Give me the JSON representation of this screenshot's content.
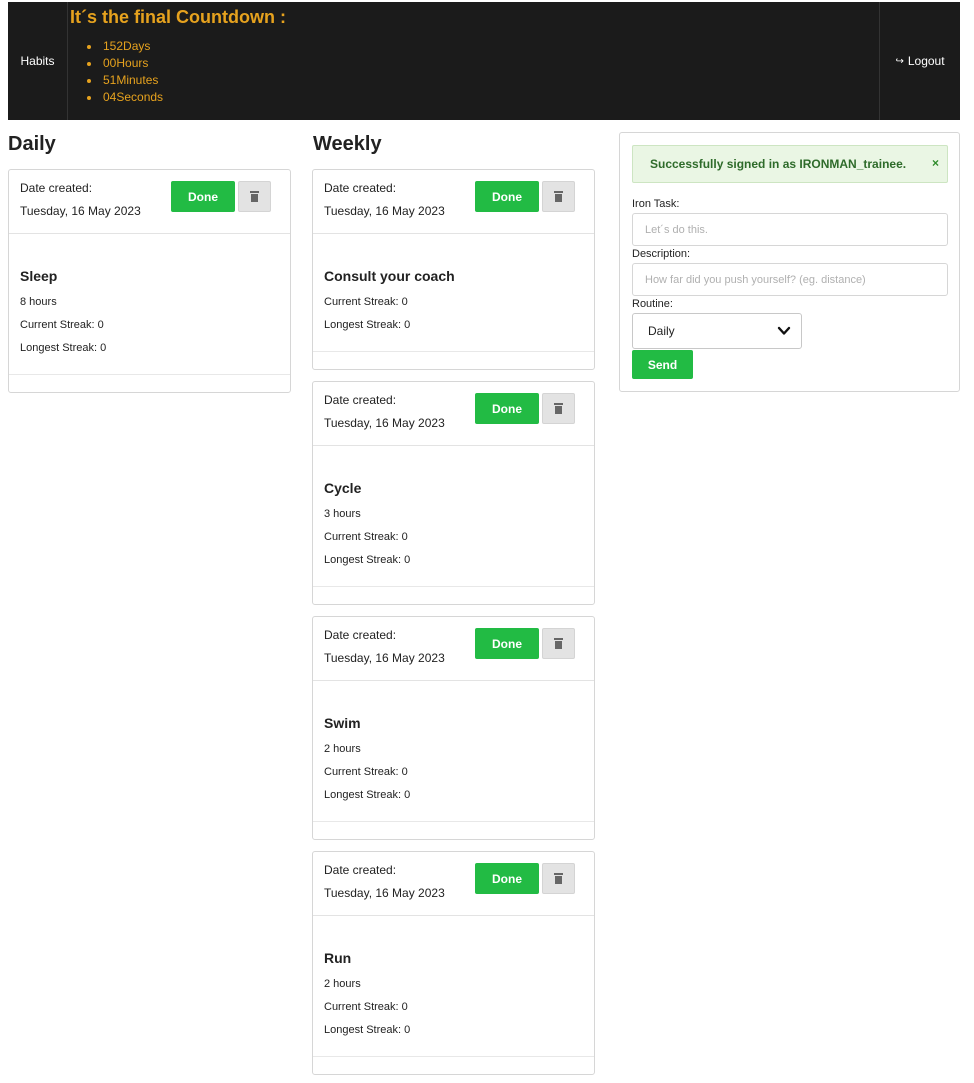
{
  "nav": {
    "brand": "Habits",
    "countdown_title": "It´s the final Countdown :",
    "countdown": [
      "152Days",
      "00Hours",
      "51Minutes",
      "04Seconds"
    ],
    "logout": "Logout"
  },
  "columns": {
    "daily": "Daily",
    "weekly": "Weekly"
  },
  "card_labels": {
    "date_created": "Date created:",
    "done": "Done"
  },
  "daily": [
    {
      "date": "Tuesday, 16 May 2023",
      "name": "Sleep",
      "duration": "8 hours",
      "current": "Current Streak: 0",
      "longest": "Longest Streak: 0"
    }
  ],
  "weekly": [
    {
      "date": "Tuesday, 16 May 2023",
      "name": "Consult your coach",
      "duration": "",
      "current": "Current Streak: 0",
      "longest": "Longest Streak: 0"
    },
    {
      "date": "Tuesday, 16 May 2023",
      "name": "Cycle",
      "duration": "3 hours",
      "current": "Current Streak: 0",
      "longest": "Longest Streak: 0"
    },
    {
      "date": "Tuesday, 16 May 2023",
      "name": "Swim",
      "duration": "2 hours",
      "current": "Current Streak: 0",
      "longest": "Longest Streak: 0"
    },
    {
      "date": "Tuesday, 16 May 2023",
      "name": "Run",
      "duration": "2 hours",
      "current": "Current Streak: 0",
      "longest": "Longest Streak: 0"
    }
  ],
  "form": {
    "alert": "Successfully signed in as IRONMAN_trainee.",
    "alert_close": "×",
    "task_label": "Iron Task:",
    "task_placeholder": "Let´s do this.",
    "desc_label": "Description:",
    "desc_placeholder": "How far did you push yourself? (eg. distance)",
    "routine_label": "Routine:",
    "routine_value": "Daily",
    "send": "Send"
  },
  "colors": {
    "accent": "#e6a21e",
    "success": "#22bb44",
    "nav_bg": "#1b1b1b"
  }
}
